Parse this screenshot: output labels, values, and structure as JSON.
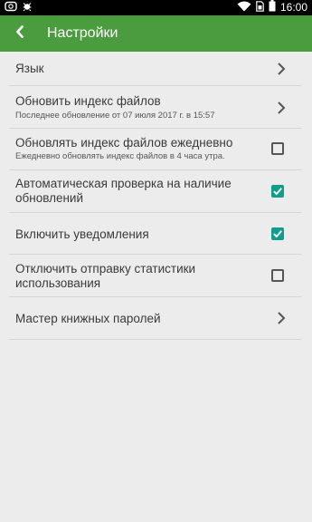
{
  "app_bar": {
    "title": "Настройки",
    "color": "#4b9b3f"
  },
  "status_bar": {
    "time": "16:00",
    "icons": [
      "app-icon",
      "bug-icon",
      "wifi-icon",
      "sim-icon",
      "battery-icon"
    ]
  },
  "settings": [
    {
      "title": "Язык",
      "control": "chevron"
    },
    {
      "title": "Обновить индекс файлов",
      "subtitle": "Последнее обновление от 07 июля 2017 г. в 15:57",
      "control": "chevron"
    },
    {
      "title": "Обновлять индекс файлов ежедневно",
      "subtitle": "Ежедневно обновлять индекс файлов в 4 часа утра.",
      "control": "checkbox",
      "checked": false
    },
    {
      "title_line1": "Автоматическая проверка на наличие",
      "title_line2": "обновлений",
      "control": "checkbox",
      "checked": true
    },
    {
      "title": "Включить уведомления",
      "control": "checkbox",
      "checked": true
    },
    {
      "title_line1": "Отключить отправку статистики",
      "title_line2": "использования",
      "control": "checkbox",
      "checked": false
    },
    {
      "title": "Мастер книжных паролей",
      "control": "chevron"
    }
  ],
  "colors": {
    "accent": "#119d8c",
    "background": "#ececec",
    "divider": "#d6d6d6"
  }
}
